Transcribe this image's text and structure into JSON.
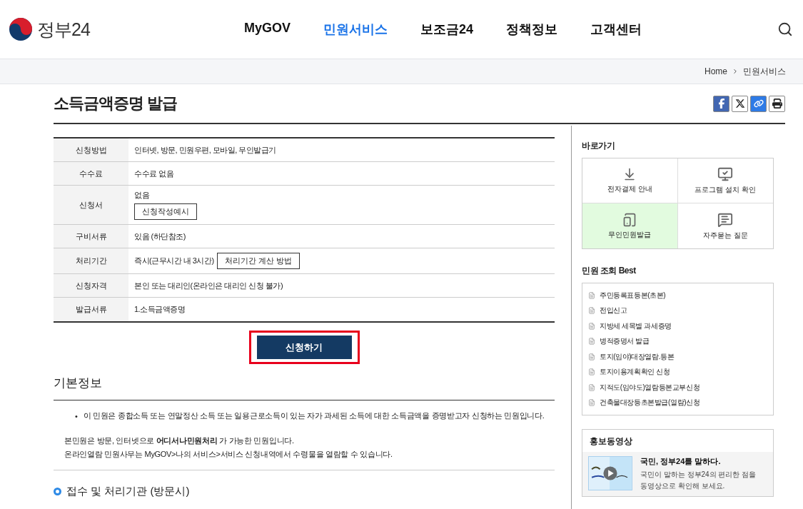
{
  "header": {
    "logo_text": "정부24",
    "nav": [
      {
        "label": "MyGOV",
        "selected": false
      },
      {
        "label": "민원서비스",
        "selected": true
      },
      {
        "label": "보조금24",
        "selected": false
      },
      {
        "label": "정책정보",
        "selected": false
      },
      {
        "label": "고객센터",
        "selected": false
      }
    ]
  },
  "breadcrumb": [
    "Home",
    "민원서비스"
  ],
  "page_title": "소득금액증명 발급",
  "info_table": [
    {
      "label": "신청방법",
      "value": "인터넷, 방문, 민원우편, 모바일, 무인발급기",
      "kind": "plain"
    },
    {
      "label": "수수료",
      "value": "수수료 없음",
      "kind": "plain"
    },
    {
      "label": "신청서",
      "value": "없음",
      "kind": "stacked",
      "button": "신청작성예시"
    },
    {
      "label": "구비서류",
      "value": "있음 (하단참조)",
      "kind": "plain"
    },
    {
      "label": "처리기간",
      "value": "즉시(근무시간 내 3시간)",
      "kind": "inline",
      "button": "처리기간 계산 방법"
    },
    {
      "label": "신청자격",
      "value": "본인 또는 대리인(온라인은 대리인 신청 불가)",
      "kind": "plain"
    },
    {
      "label": "발급서류",
      "value": "1.소득금액증명",
      "kind": "plain"
    }
  ],
  "apply_button": {
    "label": "신청하기",
    "highlighted": true
  },
  "basic_info": {
    "heading": "기본정보",
    "bullet_marker": "•",
    "bullets": [
      "이 민원은 종합소득 또는 연말정산 소득 또는 일용근로소득이 있는 자가 과세된 소득에 대한 소득금액을 증명받고자 신청하는 민원입니다."
    ],
    "notes": [
      "본민원은 방문, 인터넷으로 **어디서나민원처리** 가 가능한 민원입니다.",
      "온라인열람 민원사무는 MyGOV>나의 서비스>서비스 신청내역에서 수령물을 열람할 수 있습니다."
    ],
    "subheading": "접수 및 처리기관 (방문시)"
  },
  "shortcuts": {
    "title": "바로가기",
    "items": [
      {
        "label": "전자결제 안내",
        "kind": "download",
        "selected": false
      },
      {
        "label": "프로그램 설치 확인",
        "kind": "monitor",
        "selected": false
      },
      {
        "label": "무인민원발급",
        "kind": "kiosk",
        "selected": true
      },
      {
        "label": "자주묻는 질문",
        "kind": "faq",
        "selected": false
      }
    ]
  },
  "best": {
    "title": "민원 조회 Best",
    "items": [
      "주민등록표등본(초본)",
      "전입신고",
      "지방세 세목별 과세증명",
      "병적증명서 발급",
      "토지(임야)대장열람.등본",
      "토지이용계획확인 신청",
      "지적도(임야도)열람등본교부신청",
      "건축물대장등초본발급(열람)신청"
    ]
  },
  "promo": {
    "title": "홍보동영상",
    "video_title": "국민, 정부24를 말하다.",
    "video_desc": "국민이 말하는 정부24의 편리한 점을 동영상으로 확인해 보세요."
  }
}
